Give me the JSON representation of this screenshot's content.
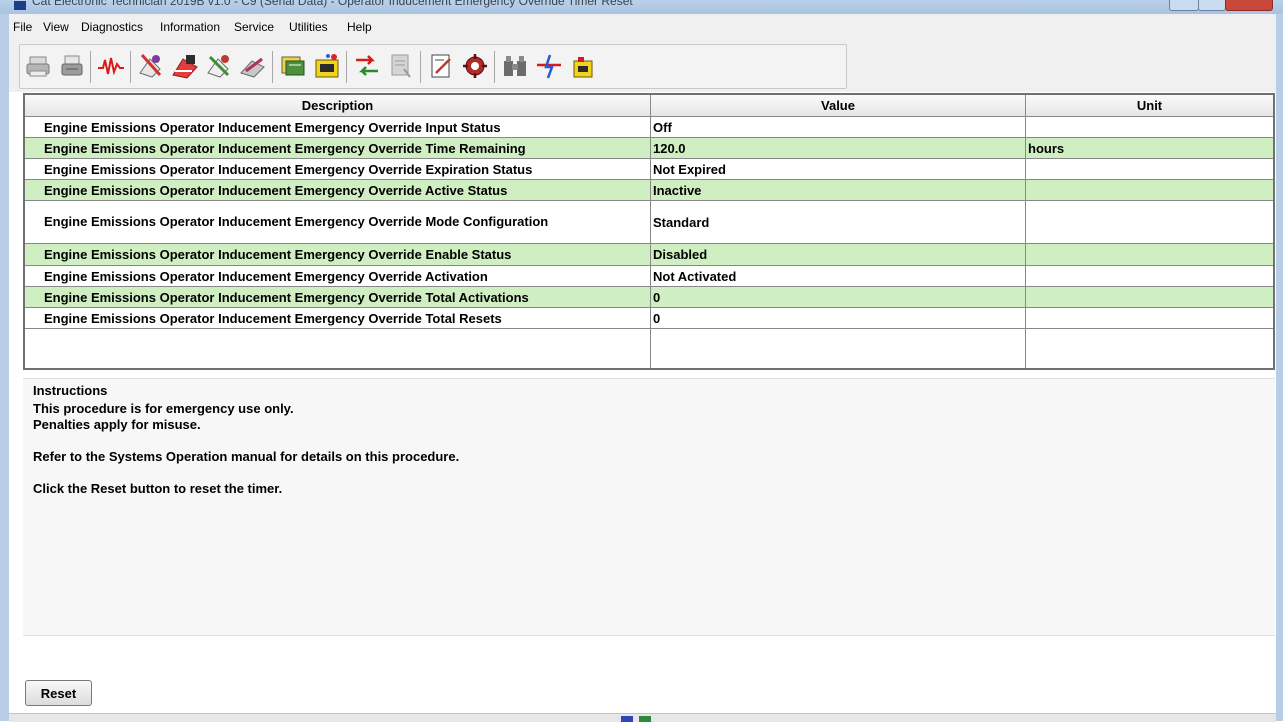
{
  "window": {
    "title": "Cat Electronic Technician 2019B v1.0 - C9 (Serial Data) - Operator Inducement Emergency Override Timer Reset"
  },
  "menu": [
    "File",
    "View",
    "Diagnostics",
    "Information",
    "Service",
    "Utilities",
    "Help"
  ],
  "toolbar": {
    "icons": [
      "print-icon",
      "print-preview-icon",
      "waveform-icon",
      "service-tool-1-icon",
      "service-tool-2-icon",
      "service-tool-3-icon",
      "service-tool-4-icon",
      "module-icon",
      "ecm-icon",
      "transfer-icon",
      "report-icon",
      "edit-icon",
      "settings-icon",
      "binoculars-icon",
      "flash-icon",
      "battery-icon"
    ]
  },
  "table": {
    "columns": [
      "Description",
      "Value",
      "Unit"
    ],
    "rows": [
      {
        "description": "Engine Emissions Operator Inducement Emergency Override Input Status",
        "value": "Off",
        "unit": ""
      },
      {
        "description": "Engine Emissions Operator Inducement Emergency Override Time Remaining",
        "value": "120.0",
        "unit": "hours"
      },
      {
        "description": "Engine Emissions Operator Inducement Emergency Override Expiration Status",
        "value": "Not Expired",
        "unit": ""
      },
      {
        "description": "Engine Emissions Operator Inducement Emergency Override Active Status",
        "value": "Inactive",
        "unit": ""
      },
      {
        "description": "Engine Emissions Operator Inducement Emergency Override Mode Configuration",
        "value": "Standard",
        "unit": ""
      },
      {
        "description": "Engine Emissions Operator Inducement Emergency Override Enable Status",
        "value": "Disabled",
        "unit": ""
      },
      {
        "description": "Engine Emissions Operator Inducement Emergency Override Activation",
        "value": "Not Activated",
        "unit": ""
      },
      {
        "description": "Engine Emissions Operator Inducement Emergency Override Total Activations",
        "value": "0",
        "unit": ""
      },
      {
        "description": "Engine Emissions Operator Inducement Emergency Override Total Resets",
        "value": "0",
        "unit": ""
      }
    ]
  },
  "instructions": {
    "title": "Instructions",
    "lines": [
      "This procedure is for emergency use only.",
      "Penalties apply for misuse.",
      "",
      "Refer to the Systems Operation manual for details on this procedure.",
      "",
      "Click the Reset button to reset the timer."
    ]
  },
  "buttons": {
    "reset": "Reset"
  },
  "colors": {
    "alt_row": "#cfeec2",
    "header": "#e6e6e6"
  }
}
